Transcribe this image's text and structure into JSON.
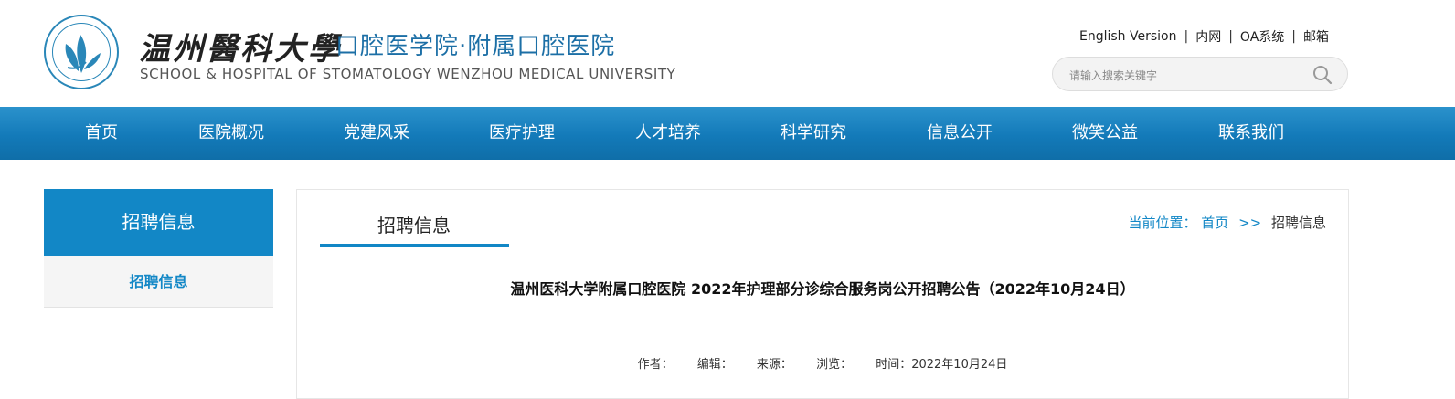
{
  "header": {
    "logo_cn": "温州醫科大學",
    "logo_sub": "口腔医学院·附属口腔医院",
    "logo_en": "SCHOOL & HOSPITAL OF STOMATOLOGY WENZHOU MEDICAL UNIVERSITY",
    "top_links": [
      "English Version",
      "内网",
      "OA系统",
      "邮箱"
    ],
    "search_placeholder": "请输入搜索关键字"
  },
  "nav": {
    "items": [
      "首页",
      "医院概况",
      "党建风采",
      "医疗护理",
      "人才培养",
      "科学研究",
      "信息公开",
      "微笑公益",
      "联系我们"
    ]
  },
  "sidebar": {
    "title": "招聘信息",
    "items": [
      "招聘信息"
    ]
  },
  "content": {
    "tab_title": "招聘信息",
    "breadcrumb": {
      "prefix": "当前位置：",
      "home": "首页",
      "arrow": ">>",
      "current": "招聘信息"
    },
    "article_title": "温州医科大学附属口腔医院 2022年护理部分诊综合服务岗公开招聘公告（2022年10月24日）",
    "meta": {
      "author": "作者：",
      "editor": "编辑：",
      "source": "来源：",
      "views": "浏览：",
      "time": "时间：2022年10月24日"
    }
  },
  "colors": {
    "brand_blue": "#1287c6",
    "nav_blue": "#137ab9"
  }
}
